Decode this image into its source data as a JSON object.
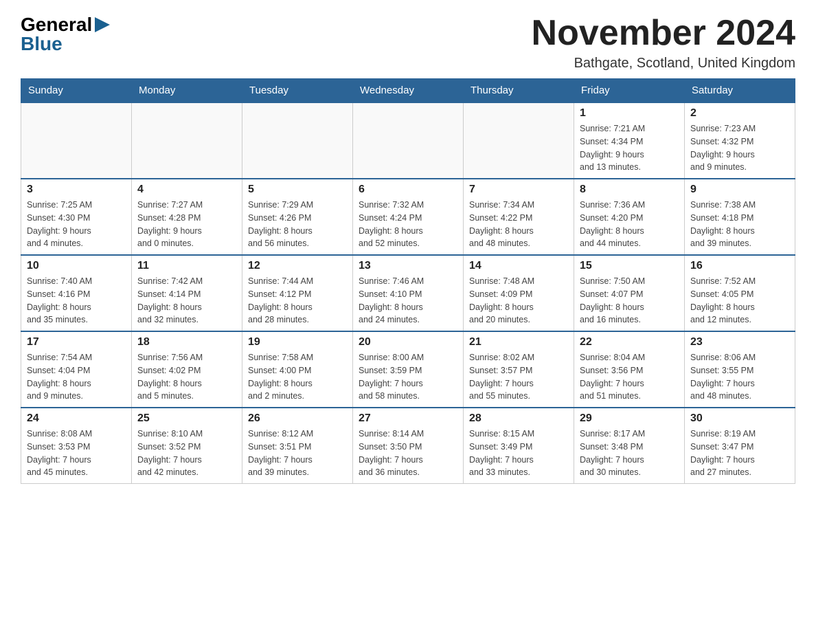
{
  "logo": {
    "general": "General",
    "arrow": "▶",
    "blue": "Blue"
  },
  "title": "November 2024",
  "location": "Bathgate, Scotland, United Kingdom",
  "days_of_week": [
    "Sunday",
    "Monday",
    "Tuesday",
    "Wednesday",
    "Thursday",
    "Friday",
    "Saturday"
  ],
  "weeks": [
    [
      {
        "day": "",
        "info": ""
      },
      {
        "day": "",
        "info": ""
      },
      {
        "day": "",
        "info": ""
      },
      {
        "day": "",
        "info": ""
      },
      {
        "day": "",
        "info": ""
      },
      {
        "day": "1",
        "info": "Sunrise: 7:21 AM\nSunset: 4:34 PM\nDaylight: 9 hours\nand 13 minutes."
      },
      {
        "day": "2",
        "info": "Sunrise: 7:23 AM\nSunset: 4:32 PM\nDaylight: 9 hours\nand 9 minutes."
      }
    ],
    [
      {
        "day": "3",
        "info": "Sunrise: 7:25 AM\nSunset: 4:30 PM\nDaylight: 9 hours\nand 4 minutes."
      },
      {
        "day": "4",
        "info": "Sunrise: 7:27 AM\nSunset: 4:28 PM\nDaylight: 9 hours\nand 0 minutes."
      },
      {
        "day": "5",
        "info": "Sunrise: 7:29 AM\nSunset: 4:26 PM\nDaylight: 8 hours\nand 56 minutes."
      },
      {
        "day": "6",
        "info": "Sunrise: 7:32 AM\nSunset: 4:24 PM\nDaylight: 8 hours\nand 52 minutes."
      },
      {
        "day": "7",
        "info": "Sunrise: 7:34 AM\nSunset: 4:22 PM\nDaylight: 8 hours\nand 48 minutes."
      },
      {
        "day": "8",
        "info": "Sunrise: 7:36 AM\nSunset: 4:20 PM\nDaylight: 8 hours\nand 44 minutes."
      },
      {
        "day": "9",
        "info": "Sunrise: 7:38 AM\nSunset: 4:18 PM\nDaylight: 8 hours\nand 39 minutes."
      }
    ],
    [
      {
        "day": "10",
        "info": "Sunrise: 7:40 AM\nSunset: 4:16 PM\nDaylight: 8 hours\nand 35 minutes."
      },
      {
        "day": "11",
        "info": "Sunrise: 7:42 AM\nSunset: 4:14 PM\nDaylight: 8 hours\nand 32 minutes."
      },
      {
        "day": "12",
        "info": "Sunrise: 7:44 AM\nSunset: 4:12 PM\nDaylight: 8 hours\nand 28 minutes."
      },
      {
        "day": "13",
        "info": "Sunrise: 7:46 AM\nSunset: 4:10 PM\nDaylight: 8 hours\nand 24 minutes."
      },
      {
        "day": "14",
        "info": "Sunrise: 7:48 AM\nSunset: 4:09 PM\nDaylight: 8 hours\nand 20 minutes."
      },
      {
        "day": "15",
        "info": "Sunrise: 7:50 AM\nSunset: 4:07 PM\nDaylight: 8 hours\nand 16 minutes."
      },
      {
        "day": "16",
        "info": "Sunrise: 7:52 AM\nSunset: 4:05 PM\nDaylight: 8 hours\nand 12 minutes."
      }
    ],
    [
      {
        "day": "17",
        "info": "Sunrise: 7:54 AM\nSunset: 4:04 PM\nDaylight: 8 hours\nand 9 minutes."
      },
      {
        "day": "18",
        "info": "Sunrise: 7:56 AM\nSunset: 4:02 PM\nDaylight: 8 hours\nand 5 minutes."
      },
      {
        "day": "19",
        "info": "Sunrise: 7:58 AM\nSunset: 4:00 PM\nDaylight: 8 hours\nand 2 minutes."
      },
      {
        "day": "20",
        "info": "Sunrise: 8:00 AM\nSunset: 3:59 PM\nDaylight: 7 hours\nand 58 minutes."
      },
      {
        "day": "21",
        "info": "Sunrise: 8:02 AM\nSunset: 3:57 PM\nDaylight: 7 hours\nand 55 minutes."
      },
      {
        "day": "22",
        "info": "Sunrise: 8:04 AM\nSunset: 3:56 PM\nDaylight: 7 hours\nand 51 minutes."
      },
      {
        "day": "23",
        "info": "Sunrise: 8:06 AM\nSunset: 3:55 PM\nDaylight: 7 hours\nand 48 minutes."
      }
    ],
    [
      {
        "day": "24",
        "info": "Sunrise: 8:08 AM\nSunset: 3:53 PM\nDaylight: 7 hours\nand 45 minutes."
      },
      {
        "day": "25",
        "info": "Sunrise: 8:10 AM\nSunset: 3:52 PM\nDaylight: 7 hours\nand 42 minutes."
      },
      {
        "day": "26",
        "info": "Sunrise: 8:12 AM\nSunset: 3:51 PM\nDaylight: 7 hours\nand 39 minutes."
      },
      {
        "day": "27",
        "info": "Sunrise: 8:14 AM\nSunset: 3:50 PM\nDaylight: 7 hours\nand 36 minutes."
      },
      {
        "day": "28",
        "info": "Sunrise: 8:15 AM\nSunset: 3:49 PM\nDaylight: 7 hours\nand 33 minutes."
      },
      {
        "day": "29",
        "info": "Sunrise: 8:17 AM\nSunset: 3:48 PM\nDaylight: 7 hours\nand 30 minutes."
      },
      {
        "day": "30",
        "info": "Sunrise: 8:19 AM\nSunset: 3:47 PM\nDaylight: 7 hours\nand 27 minutes."
      }
    ]
  ]
}
